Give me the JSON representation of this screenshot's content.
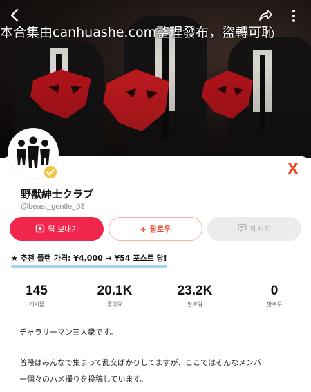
{
  "header": {
    "watermark": "本合集由canhuashe.com整理發布，盜轉可恥",
    "back_icon": "chevron-left-icon",
    "share_icon": "share-arrow-icon",
    "more_icon": "more-dots-icon"
  },
  "profile": {
    "name": "野獣紳士クラブ",
    "handle": "@beast_gentle_03",
    "close_label": "X",
    "verified_icon": "verified-badge-icon"
  },
  "actions": {
    "tip_label": "팁 보내기",
    "follow_label": "팔로우",
    "follow_prefix": "+",
    "message_label": "메시지"
  },
  "plan": {
    "text": "★ 추천 플랜 가격: ¥4,000 → ¥54 포스트 당!"
  },
  "stats": [
    {
      "value": "145",
      "label": "게시물"
    },
    {
      "value": "20.1K",
      "label": "좋아요"
    },
    {
      "value": "23.2K",
      "label": "팔로워"
    },
    {
      "value": "0",
      "label": "팔로우"
    }
  ],
  "bio": {
    "line1": "チャラリーマン三人衆です。",
    "line2": "普段はみんなで集まって乱交ばかりしてますが、ここではそんなメンバ",
    "line3": "ー個々のハメ撮りを投稿しています。"
  },
  "colors": {
    "accent": "#f0264c",
    "follow_border": "#f0b39c",
    "highlight": "#a7d4ef"
  }
}
